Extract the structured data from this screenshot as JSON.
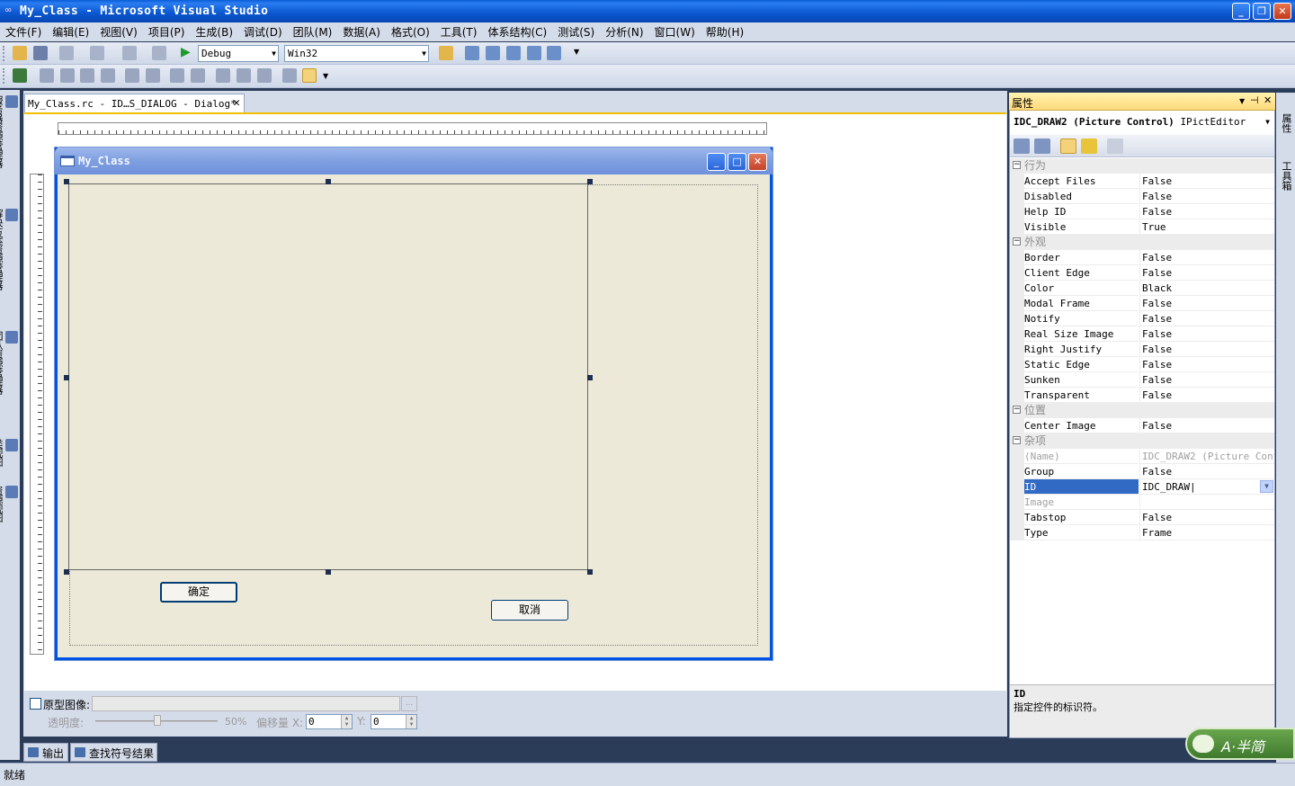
{
  "window": {
    "title": "My_Class - Microsoft Visual Studio"
  },
  "menu": [
    "文件(F)",
    "编辑(E)",
    "视图(V)",
    "项目(P)",
    "生成(B)",
    "调试(D)",
    "团队(M)",
    "数据(A)",
    "格式(O)",
    "工具(T)",
    "体系结构(C)",
    "测试(S)",
    "分析(N)",
    "窗口(W)",
    "帮助(H)"
  ],
  "toolbar": {
    "config": "Debug",
    "platform": "Win32"
  },
  "left_tabs": [
    "服务器资源管理器",
    "解决方案资源管理器",
    "团队资源管理器",
    "类视图",
    "资源视图"
  ],
  "document_tab": {
    "label": "My_Class.rc - ID…S_DIALOG - Dialog*"
  },
  "dialog": {
    "title": "My_Class",
    "ok_label": "确定",
    "cancel_label": "取消"
  },
  "prototype": {
    "label": "原型图像:",
    "browse_label": "...",
    "opacity_label": "透明度:",
    "opacity_value": "50%",
    "offset_label": "偏移量 X:",
    "x_value": "0",
    "y_label": "Y:",
    "y_value": "0"
  },
  "output_tabs": [
    "输出",
    "查找符号结果"
  ],
  "status": "就绪",
  "properties": {
    "title": "属性",
    "object_name": "IDC_DRAW2 (Picture Control)",
    "object_type": "IPictEditor",
    "groups": [
      {
        "name": "行为",
        "rows": [
          {
            "name": "Accept Files",
            "value": "False"
          },
          {
            "name": "Disabled",
            "value": "False"
          },
          {
            "name": "Help ID",
            "value": "False"
          },
          {
            "name": "Visible",
            "value": "True"
          }
        ]
      },
      {
        "name": "外观",
        "rows": [
          {
            "name": "Border",
            "value": "False"
          },
          {
            "name": "Client Edge",
            "value": "False"
          },
          {
            "name": "Color",
            "value": "Black"
          },
          {
            "name": "Modal Frame",
            "value": "False"
          },
          {
            "name": "Notify",
            "value": "False"
          },
          {
            "name": "Real Size Image",
            "value": "False"
          },
          {
            "name": "Right Justify",
            "value": "False"
          },
          {
            "name": "Static Edge",
            "value": "False"
          },
          {
            "name": "Sunken",
            "value": "False"
          },
          {
            "name": "Transparent",
            "value": "False"
          }
        ]
      },
      {
        "name": "位置",
        "rows": [
          {
            "name": "Center Image",
            "value": "False"
          }
        ]
      },
      {
        "name": "杂项",
        "rows": [
          {
            "name": "(Name)",
            "value": "IDC_DRAW2 (Picture Control)",
            "dim": true
          },
          {
            "name": "Group",
            "value": "False"
          },
          {
            "name": "ID",
            "value": "IDC_DRAW",
            "selected": true
          },
          {
            "name": "Image",
            "value": "",
            "dim": true
          },
          {
            "name": "Tabstop",
            "value": "False"
          },
          {
            "name": "Type",
            "value": "Frame"
          }
        ]
      }
    ],
    "description": {
      "name": "ID",
      "text": "指定控件的标识符。"
    }
  },
  "right_tabs": [
    "属性",
    "工具箱"
  ],
  "ime": {
    "label": "A·半简"
  },
  "colors": {
    "selection": "#316ac5",
    "titlebar": "#0a56cf",
    "dialog_face": "#ece9d8"
  }
}
